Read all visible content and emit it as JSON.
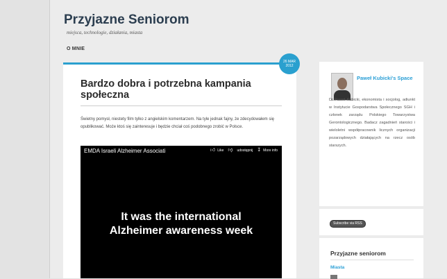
{
  "header": {
    "site_title": "Przyjazne Seniorom",
    "tagline": "miejsca, technologie, działania, miasta",
    "nav": [
      "O MNIE"
    ]
  },
  "post": {
    "date_day_month": "26 MAR",
    "date_year": "2012",
    "title": "Bardzo dobra i potrzebna kampania społeczna",
    "body": "Świetny pomysł, niestety film tylko z angielskim komentarzem. Na tyle jednak fajny, że zdecydowałem się opublikować. Może ktoś się zainteresuje i będzie chciał coś podobnego zrobić w Polsce.",
    "video": {
      "title": "EMDA Israeli Alzheimer Associati",
      "like_label": "Like",
      "share_label": "udostępnij",
      "more_label": "More info",
      "caption_line1": "It was the international",
      "caption_line2": "Alzheimer awareness week"
    }
  },
  "sidebar": {
    "profile": {
      "name": "Paweł Kubicki's Space",
      "description": "Dr Paweł Kubicki, ekonomista i socjolog, adiunkt w Instytucie Gospodarstwa Społecznego SGH i członek zarządu Polskiego Towarzystwa Gerontologicznego. Badacz zagadnień starości i wieloletni współpracownik licznych organizacji pozarządowych działających na rzecz osób starszych."
    },
    "rss_label": "Subscribe via RSS",
    "categories": {
      "title": "Przyjazne seniorom",
      "items": [
        "Miasta"
      ]
    }
  },
  "colors": {
    "accent": "#2aa0cf",
    "link": "#2a9fd6",
    "title": "#2c3e50"
  }
}
